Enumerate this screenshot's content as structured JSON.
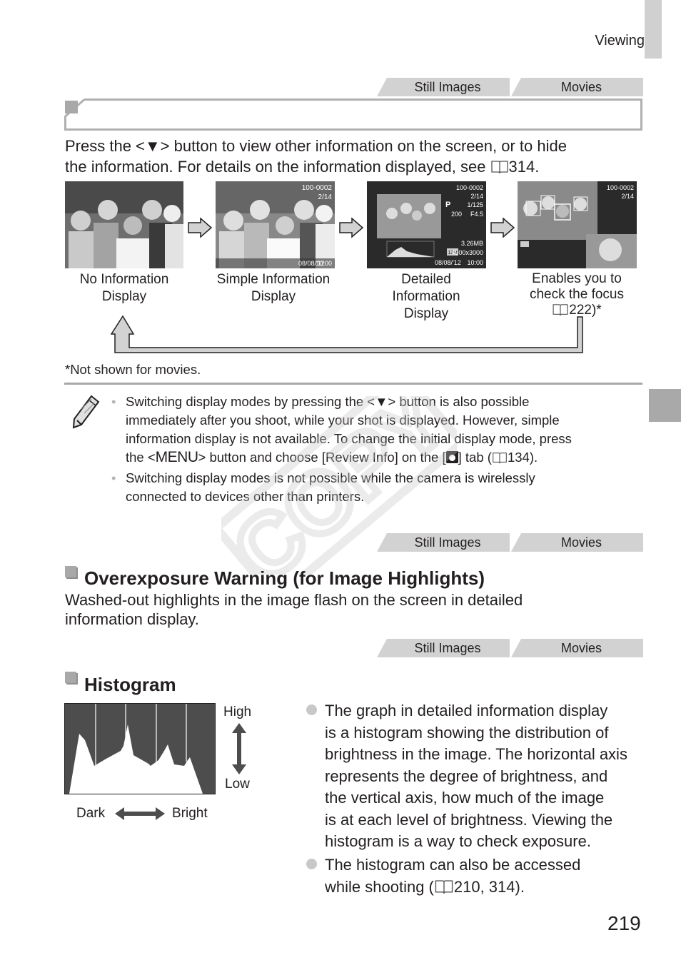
{
  "header": {
    "section": "Viewing"
  },
  "tabs": {
    "still": "Still Images",
    "movies": "Movies"
  },
  "display_switch": {
    "intro_line1": "Press the <▼> button to view other information on the screen, or to hide",
    "intro_line2_a": "the information. For details on the information displayed, see ",
    "intro_line2_ref": "314.",
    "modes": [
      {
        "label_lines": [
          "No Information",
          "Display"
        ]
      },
      {
        "label_lines": [
          "Simple Information",
          "Display"
        ],
        "overlay": {
          "file": "100-0002",
          "count": "2/14",
          "date": "08/08/'12",
          "time": "10:00"
        }
      },
      {
        "label_lines": [
          "Detailed",
          "Information",
          "Display"
        ],
        "overlay": {
          "file": "100-0002",
          "count": "2/14",
          "shutter": "1/125",
          "iso": "200",
          "aperture": "F4.5",
          "size_mb": "3.26MB",
          "resolution": "4000x3000",
          "res_badge": "12M",
          "mode": "P",
          "date": "08/08/'12",
          "time": "10:00"
        }
      },
      {
        "label_lines": [
          "Enables you to",
          "check the focus"
        ],
        "label_ref": "222)*",
        "overlay": {
          "file": "100-0002",
          "count": "2/14"
        }
      }
    ],
    "footnote": "*Not shown for movies."
  },
  "note": {
    "bullets": [
      {
        "lines": [
          "Switching display modes by pressing the <▼> button is also possible",
          "immediately after you shoot, while your shot is displayed. However, simple",
          "information display is not available. To change the initial display mode, press"
        ],
        "last_a": "the <",
        "menu": "MENU",
        "last_b": "> button and choose [Review Info] on the [",
        "last_c": "] tab (",
        "last_ref": "134)."
      },
      {
        "lines": [
          "Switching display modes is not possible while the camera is wirelessly",
          "connected to devices other than printers."
        ]
      }
    ]
  },
  "overexposure": {
    "title": "Overexposure Warning (for Image Highlights)",
    "desc_line1": "Washed-out highlights in the image flash on the screen in detailed",
    "desc_line2": "information display."
  },
  "histogram": {
    "title": "Histogram",
    "labels": {
      "high": "High",
      "low": "Low",
      "dark": "Dark",
      "bright": "Bright"
    },
    "bullets": [
      {
        "lines": [
          "The graph in detailed information display",
          "is a histogram showing the distribution of",
          "brightness in the image. The horizontal axis",
          "represents the degree of brightness, and",
          "the vertical axis, how much of the image",
          "is at each level of brightness. Viewing the",
          "histogram is a way to check exposure."
        ]
      },
      {
        "line1": "The histogram can also be accessed",
        "line2_a": "while shooting (",
        "line2_ref": "210, 314)."
      }
    ]
  },
  "watermark": "COPY",
  "page_number": "219"
}
